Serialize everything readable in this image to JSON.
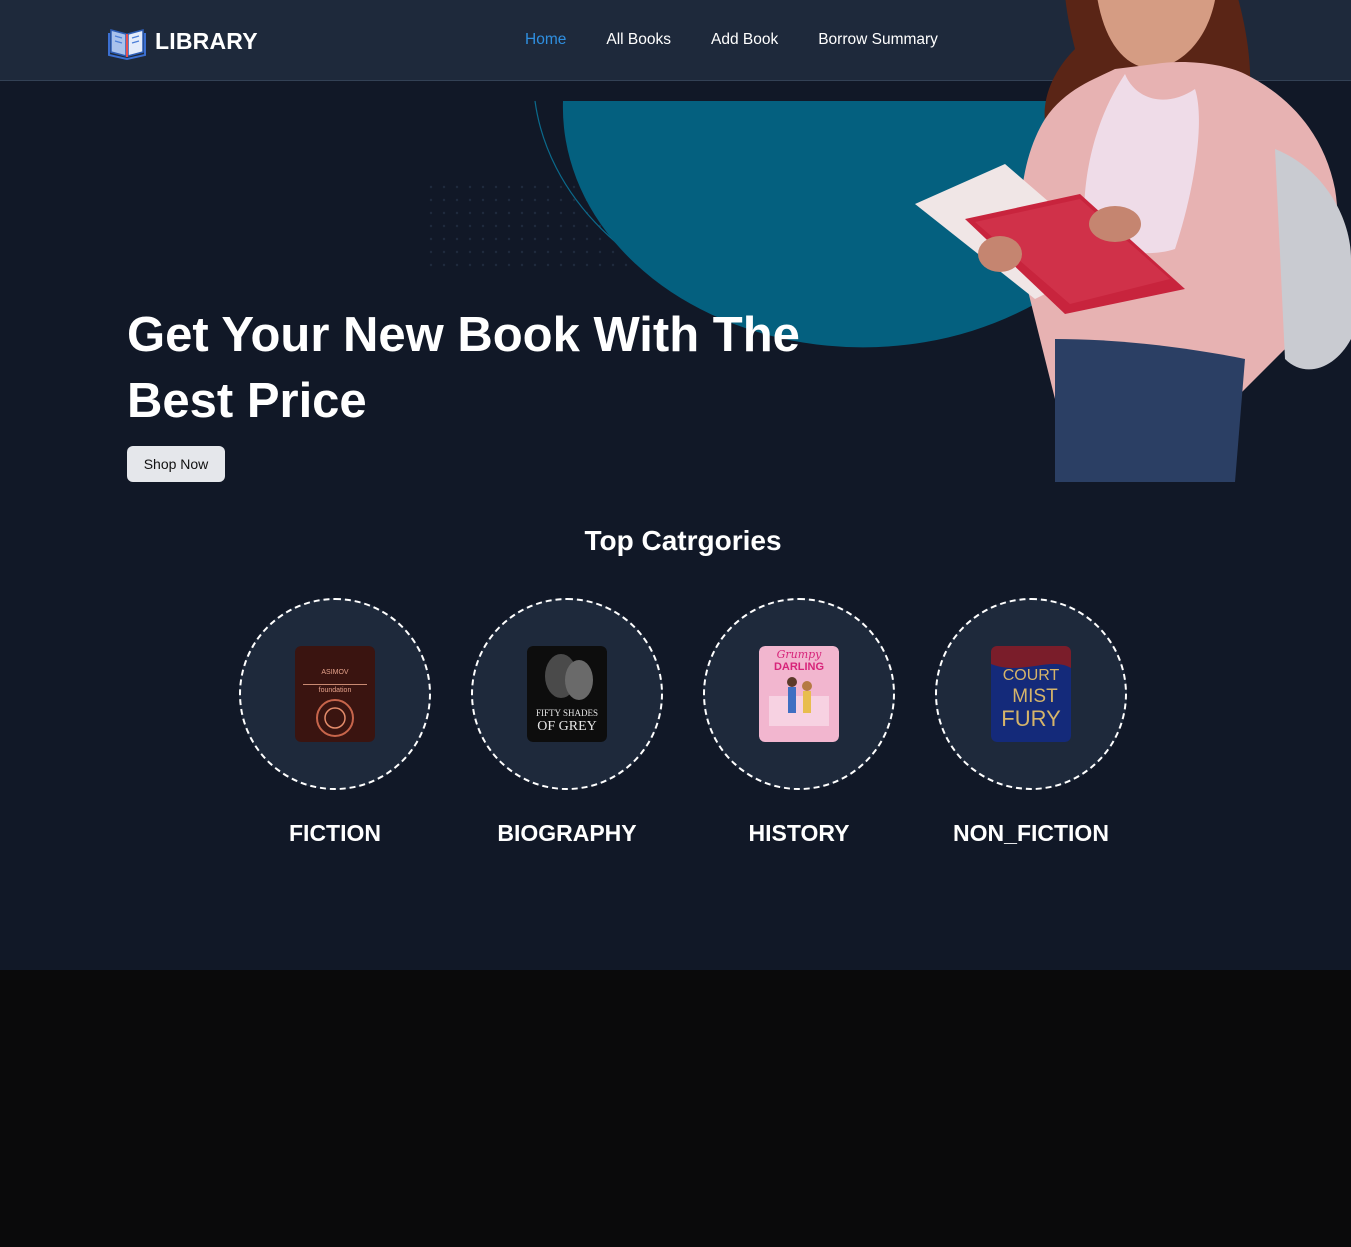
{
  "nav": {
    "brand": "LIBRARY",
    "links": [
      {
        "label": "Home",
        "active": true
      },
      {
        "label": "All Books",
        "active": false
      },
      {
        "label": "Add Book",
        "active": false
      },
      {
        "label": "Borrow Summary",
        "active": false
      }
    ]
  },
  "hero": {
    "title": "Get Your New Book With The Best Price",
    "button": "Shop Now"
  },
  "categories": {
    "title": "Top Catrgories",
    "items": [
      {
        "label": "FICTION",
        "cover_text": [
          "ASIMOV",
          "foundation"
        ]
      },
      {
        "label": "BIOGRAPHY",
        "cover_text": [
          "FIFTY SHADES",
          "OF GREY"
        ]
      },
      {
        "label": "HISTORY",
        "cover_text": [
          "Grumpy",
          "DARLING"
        ]
      },
      {
        "label": "NON_FICTION",
        "cover_text": [
          "COURT",
          "MIST",
          "FURY"
        ]
      }
    ]
  },
  "colors": {
    "nav_bg": "#1e293b",
    "page_bg": "#111827",
    "accent": "#2f8fe0",
    "teal": "#04607f",
    "footer_bg": "#0a0a0b"
  },
  "icons": {
    "brand": "open-book-icon"
  }
}
